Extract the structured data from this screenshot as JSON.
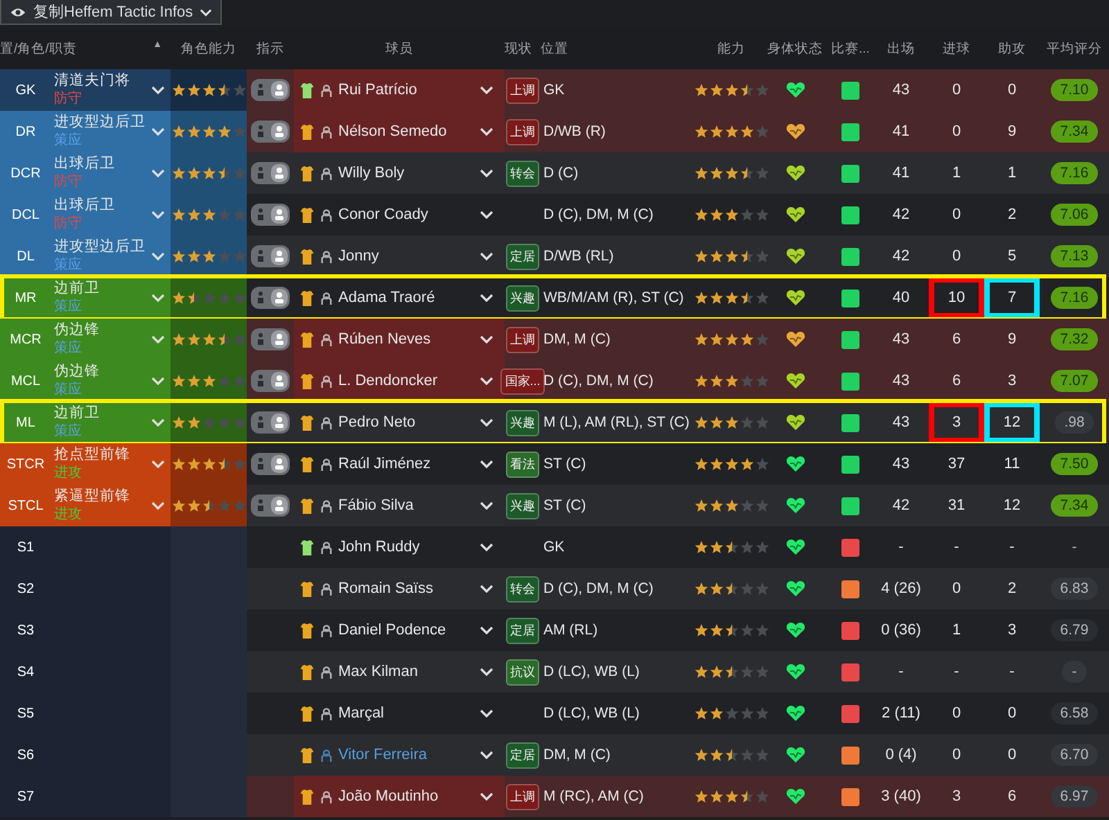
{
  "toolbar": {
    "view_button": "复制Heffem Tactic Infos"
  },
  "table": {
    "columns": [
      "置/角色/职责",
      "角色能力",
      "指示",
      "球员",
      "现状",
      "位置",
      "能力",
      "身体状态",
      "比赛...",
      "出场",
      "进球",
      "助攻",
      "平均评分"
    ],
    "sort_mark": "▲",
    "rows": [
      {
        "code": "GK",
        "color": "#1f3e60",
        "role": {
          "name": "清道夫门将",
          "duty": {
            "text": "防守",
            "color": "#e0484a"
          },
          "stars": 3.5
        },
        "red_tint": true,
        "player": {
          "name": "Rui Patrício",
          "color": "#e8e8e8",
          "shirt": {
            "color": "#8ee070"
          }
        },
        "status": {
          "text": "上调",
          "color": "#7a1a1a"
        },
        "position": "GK",
        "ability": {
          "stars": 3.5
        },
        "condition": {
          "color": "#22e86a"
        },
        "sharpness": {
          "kind": "up"
        },
        "apps": "43",
        "goals": {
          "text": "0"
        },
        "assists": {
          "text": "0"
        },
        "rating": {
          "text": "7.10",
          "color": "#5a9e14"
        },
        "highlight": false
      },
      {
        "code": "DR",
        "color": "#2f6fa5",
        "role": {
          "name": "进攻型边后卫",
          "duty": {
            "text": "策应",
            "color": "#5aa0e8"
          },
          "stars": 4
        },
        "red_tint": true,
        "player": {
          "name": "Nélson Semedo",
          "color": "#e8e8e8",
          "shirt": {
            "color": "#e8a620"
          }
        },
        "status": {
          "text": "上调",
          "color": "#7a1a1a"
        },
        "position": "D/WB (R)",
        "ability": {
          "stars": 4
        },
        "condition": {
          "color": "#e8a83a"
        },
        "sharpness": {
          "kind": "up"
        },
        "apps": "41",
        "goals": {
          "text": "0"
        },
        "assists": {
          "text": "9"
        },
        "rating": {
          "text": "7.34",
          "color": "#5a9e14"
        },
        "highlight": false
      },
      {
        "code": "DCR",
        "color": "#2f6fa5",
        "role": {
          "name": "出球后卫",
          "duty": {
            "text": "防守",
            "color": "#e0484a"
          },
          "stars": 3.5
        },
        "red_tint": false,
        "player": {
          "name": "Willy Boly",
          "color": "#e8e8e8",
          "shirt": {
            "color": "#e8a620"
          }
        },
        "status": {
          "text": "转会",
          "color": "#1d5a2a"
        },
        "position": "D (C)",
        "ability": {
          "stars": 3.5
        },
        "condition": {
          "color": "#a8d42a"
        },
        "sharpness": {
          "kind": "up"
        },
        "apps": "41",
        "goals": {
          "text": "1"
        },
        "assists": {
          "text": "1"
        },
        "rating": {
          "text": "7.16",
          "color": "#5a9e14"
        },
        "highlight": false
      },
      {
        "code": "DCL",
        "color": "#2f6fa5",
        "role": {
          "name": "出球后卫",
          "duty": {
            "text": "防守",
            "color": "#e0484a"
          },
          "stars": 3
        },
        "red_tint": false,
        "player": {
          "name": "Conor Coady",
          "color": "#e8e8e8",
          "shirt": {
            "color": "#e8a620"
          }
        },
        "position": "D (C), DM, M (C)",
        "ability": {
          "stars": 3
        },
        "condition": {
          "color": "#a8d42a"
        },
        "sharpness": {
          "kind": "up"
        },
        "apps": "42",
        "goals": {
          "text": "0"
        },
        "assists": {
          "text": "2"
        },
        "rating": {
          "text": "7.06",
          "color": "#5a9e14"
        },
        "highlight": false
      },
      {
        "code": "DL",
        "color": "#2f6fa5",
        "role": {
          "name": "进攻型边后卫",
          "duty": {
            "text": "策应",
            "color": "#5aa0e8"
          },
          "stars": 3
        },
        "red_tint": false,
        "player": {
          "name": "Jonny",
          "color": "#e8e8e8",
          "shirt": {
            "color": "#e8a620"
          }
        },
        "status": {
          "text": "定居",
          "color": "#1d5a2a"
        },
        "position": "D/WB (RL)",
        "ability": {
          "stars": 3.5
        },
        "condition": {
          "color": "#a8d42a"
        },
        "sharpness": {
          "kind": "up"
        },
        "apps": "42",
        "goals": {
          "text": "0"
        },
        "assists": {
          "text": "5"
        },
        "rating": {
          "text": "7.13",
          "color": "#5a9e14"
        },
        "highlight": false
      },
      {
        "code": "MR",
        "color": "#3d8a1e",
        "role": {
          "name": "边前卫",
          "duty": {
            "text": "策应",
            "color": "#5aa0e8"
          },
          "stars": 1.5
        },
        "red_tint": false,
        "player": {
          "name": "Adama Traoré",
          "color": "#e8e8e8",
          "shirt": {
            "color": "#e8a620"
          }
        },
        "status": {
          "text": "兴趣",
          "color": "#1d5a2a"
        },
        "position": "WB/M/AM (R), ST (C)",
        "ability": {
          "stars": 3.5
        },
        "condition": {
          "color": "#a8d42a"
        },
        "sharpness": {
          "kind": "up"
        },
        "apps": "40",
        "goals": {
          "text": "10",
          "color": "#ff0000"
        },
        "assists": {
          "text": "7",
          "color": "#00e5ff"
        },
        "rating": {
          "text": "7.16",
          "color": "#5a9e14"
        },
        "highlight": true
      },
      {
        "code": "MCR",
        "color": "#3d8a1e",
        "role": {
          "name": "伪边锋",
          "duty": {
            "text": "策应",
            "color": "#5aa0e8"
          },
          "stars": 3.5
        },
        "red_tint": true,
        "player": {
          "name": "Rúben Neves",
          "color": "#e8e8e8",
          "shirt": {
            "color": "#e8a620"
          }
        },
        "status": {
          "text": "上调",
          "color": "#7a1a1a"
        },
        "position": "DM, M (C)",
        "ability": {
          "stars": 4
        },
        "condition": {
          "color": "#e8a83a"
        },
        "sharpness": {
          "kind": "up"
        },
        "apps": "43",
        "goals": {
          "text": "6"
        },
        "assists": {
          "text": "9"
        },
        "rating": {
          "text": "7.32",
          "color": "#5a9e14"
        },
        "highlight": false
      },
      {
        "code": "MCL",
        "color": "#3d8a1e",
        "role": {
          "name": "伪边锋",
          "duty": {
            "text": "策应",
            "color": "#5aa0e8"
          },
          "stars": 3
        },
        "red_tint": true,
        "player": {
          "name": "L. Dendoncker",
          "color": "#e8e8e8",
          "shirt": {
            "color": "#e8a620"
          }
        },
        "status": {
          "text": "国家...",
          "color": "#7a1a1a"
        },
        "position": "D (C), DM, M (C)",
        "ability": {
          "stars": 3
        },
        "condition": {
          "color": "#a8d42a"
        },
        "sharpness": {
          "kind": "up"
        },
        "apps": "43",
        "goals": {
          "text": "6"
        },
        "assists": {
          "text": "3"
        },
        "rating": {
          "text": "7.07",
          "color": "#5a9e14"
        },
        "highlight": false
      },
      {
        "code": "ML",
        "color": "#3d8a1e",
        "role": {
          "name": "边前卫",
          "duty": {
            "text": "策应",
            "color": "#5aa0e8"
          },
          "stars": 2
        },
        "red_tint": false,
        "player": {
          "name": "Pedro Neto",
          "color": "#e8e8e8",
          "shirt": {
            "color": "#e8a620"
          }
        },
        "status": {
          "text": "兴趣",
          "color": "#1d5a2a"
        },
        "position": "M (L), AM (RL), ST (C)",
        "ability": {
          "stars": 3
        },
        "condition": {
          "color": "#a8d42a"
        },
        "sharpness": {
          "kind": "up"
        },
        "apps": "43",
        "goals": {
          "text": "3",
          "color": "#ff0000"
        },
        "assists": {
          "text": "12",
          "color": "#00e5ff"
        },
        "rating": {
          "text": ".98",
          "color": "#34373b"
        },
        "highlight": true
      },
      {
        "code": "STCR",
        "color": "#c4420f",
        "role": {
          "name": "抢点型前锋",
          "duty": {
            "text": "进攻",
            "color": "#3ed03e"
          },
          "stars": 3.5
        },
        "red_tint": false,
        "player": {
          "name": "Raúl Jiménez",
          "color": "#e8e8e8",
          "shirt": {
            "color": "#e8a620"
          }
        },
        "status": {
          "text": "看法",
          "color": "#2a6a2a"
        },
        "position": "ST (C)",
        "ability": {
          "stars": 4
        },
        "condition": {
          "color": "#22e86a"
        },
        "sharpness": {
          "kind": "up"
        },
        "apps": "43",
        "goals": {
          "text": "37"
        },
        "assists": {
          "text": "11"
        },
        "rating": {
          "text": "7.50",
          "color": "#5a9e14"
        },
        "highlight": false
      },
      {
        "code": "STCL",
        "color": "#c4420f",
        "role": {
          "name": "紧逼型前锋",
          "duty": {
            "text": "进攻",
            "color": "#3ed03e"
          },
          "stars": 2.5
        },
        "red_tint": false,
        "player": {
          "name": "Fábio Silva",
          "color": "#e8e8e8",
          "shirt": {
            "color": "#e8a620"
          }
        },
        "status": {
          "text": "兴趣",
          "color": "#1d5a2a"
        },
        "position": "ST (C)",
        "ability": {
          "stars": 3
        },
        "condition": {
          "color": "#22e86a"
        },
        "sharpness": {
          "kind": "up"
        },
        "apps": "42",
        "goals": {
          "text": "31"
        },
        "assists": {
          "text": "12"
        },
        "rating": {
          "text": "7.34",
          "color": "#5a9e14"
        },
        "highlight": false
      },
      {
        "code": "S1",
        "color": "#1c2433",
        "red_tint": false,
        "player": {
          "name": "John Ruddy",
          "color": "#e8e8e8",
          "shirt": {
            "color": "#8ee070"
          }
        },
        "position": "GK",
        "ability": {
          "stars": 2.5
        },
        "condition": {
          "color": "#22e86a"
        },
        "sharpness": {
          "kind": "down"
        },
        "apps": "-",
        "goals": {
          "text": "-"
        },
        "assists": {
          "text": "-"
        },
        "rating": {
          "text": "-"
        },
        "highlight": false
      },
      {
        "code": "S2",
        "color": "#1c2433",
        "red_tint": false,
        "player": {
          "name": "Romain Saïss",
          "color": "#e8e8e8",
          "shirt": {
            "color": "#e8a620"
          }
        },
        "status": {
          "text": "转会",
          "color": "#1d5a2a"
        },
        "position": "D (C), DM, M (C)",
        "ability": {
          "stars": 2.5
        },
        "condition": {
          "color": "#22e86a"
        },
        "sharpness": {
          "kind": "low"
        },
        "apps": "4 (26)",
        "goals": {
          "text": "0"
        },
        "assists": {
          "text": "2"
        },
        "rating": {
          "text": "6.83",
          "color": "#34373b"
        },
        "highlight": false
      },
      {
        "code": "S3",
        "color": "#1c2433",
        "red_tint": false,
        "player": {
          "name": "Daniel Podence",
          "color": "#e8e8e8",
          "shirt": {
            "color": "#e8a620"
          }
        },
        "status": {
          "text": "定居",
          "color": "#1d5a2a"
        },
        "position": "AM (RL)",
        "ability": {
          "stars": 2.5
        },
        "condition": {
          "color": "#22e86a"
        },
        "sharpness": {
          "kind": "down"
        },
        "apps": "0 (36)",
        "goals": {
          "text": "1"
        },
        "assists": {
          "text": "3"
        },
        "rating": {
          "text": "6.79",
          "color": "#2a2d31"
        },
        "highlight": false
      },
      {
        "code": "S4",
        "color": "#1c2433",
        "red_tint": false,
        "player": {
          "name": "Max Kilman",
          "color": "#e8e8e8",
          "shirt": {
            "color": "#e8a620"
          }
        },
        "status": {
          "text": "抗议",
          "color": "#2a6a2a"
        },
        "position": "D (LC), WB (L)",
        "ability": {
          "stars": 2.5
        },
        "condition": {
          "color": "#22e86a"
        },
        "sharpness": {
          "kind": "down"
        },
        "apps": "-",
        "goals": {
          "text": "-"
        },
        "assists": {
          "text": "-"
        },
        "rating": {
          "text": "-",
          "color": "#34373b"
        },
        "highlight": false
      },
      {
        "code": "S5",
        "color": "#1c2433",
        "red_tint": false,
        "player": {
          "name": "Marçal",
          "color": "#e8e8e8",
          "shirt": {
            "color": "#e8a620"
          }
        },
        "position": "D (LC), WB (L)",
        "ability": {
          "stars": 2
        },
        "condition": {
          "color": "#22e86a"
        },
        "sharpness": {
          "kind": "down"
        },
        "apps": "2 (11)",
        "goals": {
          "text": "0"
        },
        "assists": {
          "text": "0"
        },
        "rating": {
          "text": "6.58",
          "color": "#2a2d31"
        },
        "highlight": false
      },
      {
        "code": "S6",
        "color": "#1c2433",
        "red_tint": false,
        "player": {
          "name": "Vitor Ferreira",
          "color": "#5a9ee0",
          "shirt": {
            "color": "#e8a620"
          }
        },
        "status": {
          "text": "定居",
          "color": "#1d5a2a"
        },
        "position": "DM, M (C)",
        "ability": {
          "stars": 2.5
        },
        "condition": {
          "color": "#22e86a"
        },
        "sharpness": {
          "kind": "low"
        },
        "apps": "0 (4)",
        "goals": {
          "text": "0"
        },
        "assists": {
          "text": "0"
        },
        "rating": {
          "text": "6.70",
          "color": "#34373b"
        },
        "highlight": false
      },
      {
        "code": "S7",
        "color": "#1c2433",
        "red_tint": true,
        "player": {
          "name": "João Moutinho",
          "color": "#e8e8e8",
          "shirt": {
            "color": "#e8a620"
          }
        },
        "status": {
          "text": "上调",
          "color": "#7a1a1a"
        },
        "position": "M (RC), AM (C)",
        "ability": {
          "stars": 3.5
        },
        "condition": {
          "color": "#22e86a"
        },
        "sharpness": {
          "kind": "low"
        },
        "apps": "3 (40)",
        "goals": {
          "text": "3"
        },
        "assists": {
          "text": "6"
        },
        "rating": {
          "text": "6.97",
          "color": "#34373b"
        },
        "highlight": false
      }
    ]
  }
}
